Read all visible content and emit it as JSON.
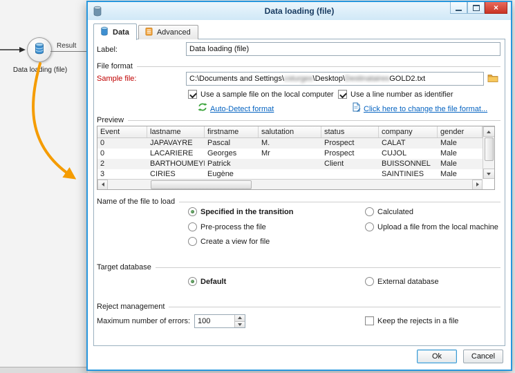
{
  "window": {
    "title": "Data loading (file)"
  },
  "icons": {
    "close_glyph": "×"
  },
  "canvas": {
    "node_label": "Data loading (file)",
    "transition_label": "Result"
  },
  "tabs": [
    {
      "label": "Data"
    },
    {
      "label": "Advanced"
    }
  ],
  "states": {
    "active_tab": "Data",
    "cb_local": true,
    "cb_line": true,
    "cb_keep": false,
    "selected_file_option": "Specified in the transition",
    "selected_target": "Default"
  },
  "label_field": {
    "caption": "Label:",
    "value": "Data loading (file)"
  },
  "file_format": {
    "group": "File format",
    "sample_caption": "Sample file:",
    "path": {
      "p0": "C:\\Documents and Settings\\",
      "p1": "csturges",
      "p2": "\\Desktop\\",
      "p3": "Destinataires",
      "p4": "GOLD2.txt"
    },
    "cb_local": "Use a sample file on the local computer",
    "cb_line": "Use a line number as identifier",
    "link_autodetect": "Auto-Detect format",
    "link_change": "Click here to change the file format..."
  },
  "preview": {
    "group": "Preview",
    "headers": [
      "Event",
      "lastname",
      "firstname",
      "salutation",
      "status",
      "company",
      "gender"
    ],
    "rows": [
      [
        "0",
        "JAPAVAYRE",
        "Pascal",
        "M.",
        "Prospect",
        "CALAT",
        "Male"
      ],
      [
        "0",
        "LACARIERE",
        "Georges",
        "Mr",
        "Prospect",
        "CUJOL",
        "Male"
      ],
      [
        "2",
        "BARTHOUMEYRIE",
        "Patrick",
        "",
        "Client",
        "BUISSONNEL",
        "Male"
      ],
      [
        "3",
        "CIRIES",
        "Eugène",
        "",
        "",
        "SAINTINIES",
        "Male"
      ]
    ]
  },
  "file_to_load": {
    "group": "Name of the file to load",
    "opt_specified": "Specified in the transition",
    "opt_preprocess": "Pre-process the file",
    "opt_view": "Create a view for file",
    "opt_calculated": "Calculated",
    "opt_upload": "Upload a file from the local machine"
  },
  "target_db": {
    "group": "Target database",
    "opt_default": "Default",
    "opt_external": "External database"
  },
  "rejects": {
    "group": "Reject management",
    "max_caption": "Maximum number of errors:",
    "max_value": "100",
    "cb_keep": "Keep the rejects in a file"
  },
  "footer": {
    "ok": "Ok",
    "cancel": "Cancel"
  }
}
